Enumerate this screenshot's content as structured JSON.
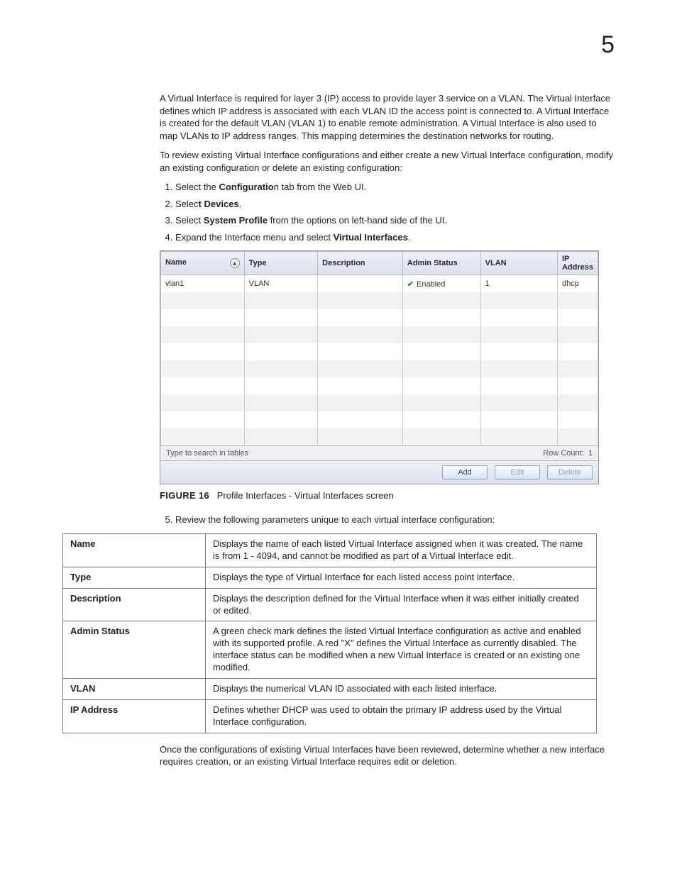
{
  "chapter_number": "5",
  "paragraph_intro": "A Virtual Interface is required for layer 3 (IP) access to provide layer 3 service on a VLAN. The Virtual Interface defines which IP address is associated with each VLAN ID the access point is connected to. A Virtual Interface is created for the default VLAN (VLAN 1) to enable remote administration. A Virtual Interface is also used to map VLANs to IP address ranges. This mapping determines the destination networks for routing.",
  "paragraph_lead": "To review existing Virtual Interface configurations and either create a new Virtual Interface configuration, modify an existing configuration or delete an existing configuration:",
  "steps": {
    "s1_a": "Select the ",
    "s1_b": "Configuratio",
    "s1_b2": "n tab from the Web UI.",
    "s2_a": "Selec",
    "s2_b": "t Devices",
    "s2_c": ".",
    "s3_a": "Select ",
    "s3_b": "System Profile",
    "s3_c": " from the options on left-hand side of the UI.",
    "s4_a": "Expand the Interface menu and select ",
    "s4_b": "Virtual Interfaces",
    "s4_c": "."
  },
  "vi_screen": {
    "cols": [
      "Name",
      "Type",
      "Description",
      "Admin Status",
      "VLAN",
      "IP Address"
    ],
    "row": {
      "name": "vlan1",
      "type": "VLAN",
      "desc": "",
      "status": "Enabled",
      "vlan": "1",
      "ip": "dhcp"
    },
    "search_placeholder": "Type to search in tables",
    "rowcount_label": "Row Count:",
    "rowcount_value": "1",
    "btn_add": "Add",
    "btn_edit": "Edit",
    "btn_delete": "Delete"
  },
  "figure": {
    "label": "FIGURE 16",
    "caption": "Profile Interfaces - Virtual Interfaces screen"
  },
  "step5": "Review the following parameters unique to each virtual interface configuration:",
  "params": [
    {
      "k": "Name",
      "v": "Displays the name of each listed Virtual Interface assigned when it was created. The name is from 1 - 4094, and cannot be modified as part of a Virtual Interface edit."
    },
    {
      "k": "Type",
      "v": "Displays the type of Virtual Interface for each listed access point interface."
    },
    {
      "k": "Description",
      "v": "Displays the description defined for the Virtual Interface when it was either initially created or edited."
    },
    {
      "k": "Admin Status",
      "v": "A green check mark defines the listed Virtual Interface configuration as active and enabled with its supported profile. A red \"X\" defines the Virtual Interface as currently disabled. The interface status can be modified when a new Virtual Interface is created or an existing one modified."
    },
    {
      "k": "VLAN",
      "v": "Displays the numerical VLAN ID associated with each listed interface."
    },
    {
      "k": "IP Address",
      "v": "Defines whether DHCP was used to obtain the primary IP address used by the Virtual Interface configuration."
    }
  ],
  "paragraph_after": "Once the configurations of existing Virtual Interfaces have been reviewed, determine whether a new interface requires creation, or an existing Virtual Interface requires edit or deletion."
}
